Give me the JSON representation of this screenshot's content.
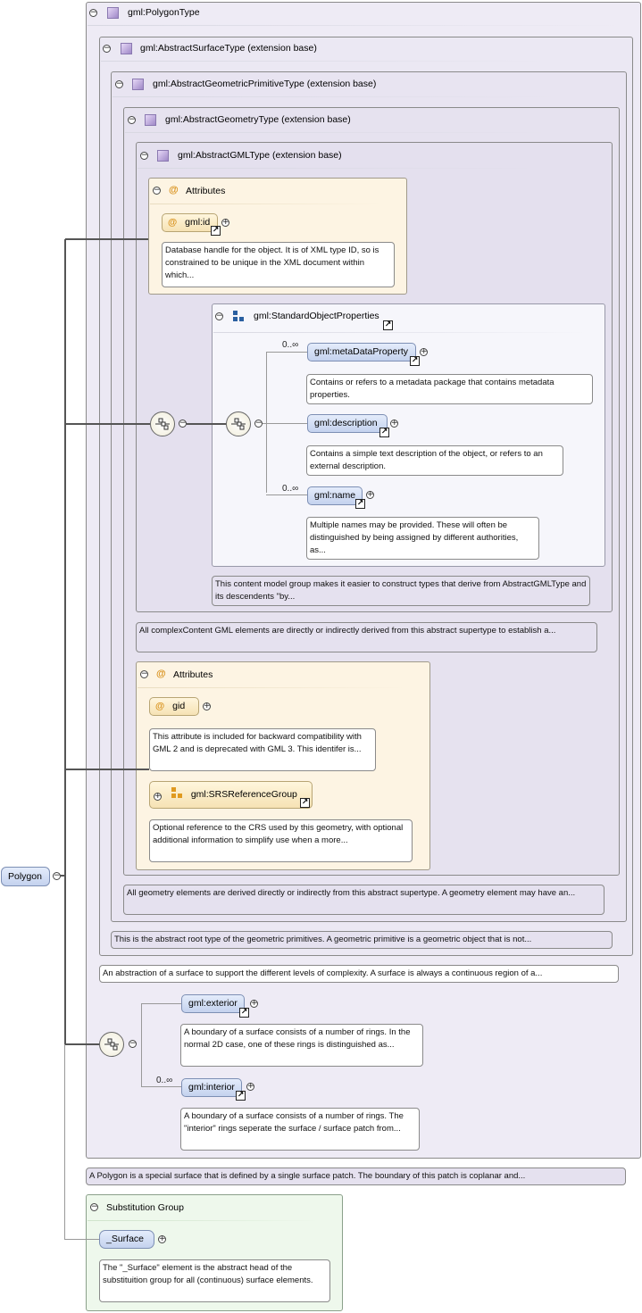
{
  "root": {
    "label": "Polygon"
  },
  "types": {
    "polygon": "gml:PolygonType",
    "surface": "gml:AbstractSurfaceType (extension base)",
    "primitive": "gml:AbstractGeometricPrimitiveType (extension base)",
    "geometry": "gml:AbstractGeometryType (extension base)",
    "gml": "gml:AbstractGMLType (extension base)"
  },
  "gml_attributes": {
    "title": "Attributes",
    "id_label": "gml:id",
    "id_doc": "Database handle for the object. It is of XML type ID, so is constrained to be unique in the XML document within which..."
  },
  "std_props": {
    "title": "gml:StandardObjectProperties",
    "metadata_card": "0..∞",
    "metadata_label": "gml:metaDataProperty",
    "metadata_doc": "Contains or refers to a metadata package that contains metadata properties.",
    "description_label": "gml:description",
    "description_doc": "Contains a simple text description of the object, or refers to an external description.",
    "name_card": "0..∞",
    "name_label": "gml:name",
    "name_doc": "Multiple names may be provided. These will often be distinguished by being assigned by different authorities, as...",
    "group_doc": "This content model group makes it easier to construct types that derive from AbstractGMLType and its descendents \"by..."
  },
  "gml_type_doc": "All complexContent GML elements are directly or indirectly derived from this abstract supertype to establish a...",
  "geom_attributes": {
    "title": "Attributes",
    "gid_label": "gid",
    "gid_doc": "This attribute is included for backward compatibility with GML 2 and is deprecated with GML 3. This identifer is...",
    "srs_label": "gml:SRSReferenceGroup",
    "srs_doc": "Optional reference to the CRS used by this geometry, with optional additional information to simplify use when a more..."
  },
  "geometry_doc": "All geometry elements are derived directly or indirectly from this abstract supertype. A geometry element may have an...",
  "primitive_doc": "This is the abstract root type of the geometric primitives. A geometric primitive is a geometric object that is not...",
  "surface_doc": "An abstraction of a surface to support the different levels of complexity. A surface is always a continuous region of a...",
  "polygon_seq": {
    "exterior_label": "gml:exterior",
    "exterior_doc": "A boundary of a surface consists of a number of rings. In the normal 2D case, one of these rings is distinguished as...",
    "interior_card": "0..∞",
    "interior_label": "gml:interior",
    "interior_doc": "A boundary of a surface consists of a number of rings. The \"interior\" rings seperate the surface / surface patch from..."
  },
  "polygon_doc": "A Polygon is a special surface that is defined by a single surface patch. The boundary of this patch is coplanar and...",
  "substitution": {
    "title": "Substitution Group",
    "label": "_Surface",
    "doc": "The \"_Surface\" element is the abstract head of the substituition group for all (continuous) surface elements."
  },
  "icons": {
    "collapse": "minus-circle-icon",
    "expand": "plus-circle-icon",
    "reference": "arrow-link-icon",
    "type": "complex-type-icon",
    "attribute": "at-sign-icon",
    "group": "group-icon",
    "sequence": "sequence-compositor-icon"
  },
  "colors": {
    "type_fill": "#eeebf5",
    "attribute_fill": "#fdf4e3",
    "element_fill": "#c4d2ee",
    "substitution_fill": "#eef8ec"
  }
}
